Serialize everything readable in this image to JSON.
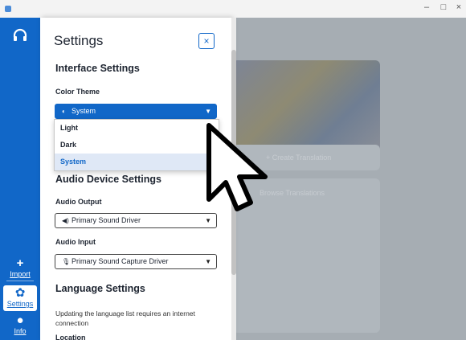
{
  "window": {
    "minimize": "–",
    "maximize": "□",
    "close": "×"
  },
  "rail": {
    "import_label": "Import",
    "settings_label": "Settings",
    "info_label": "Info"
  },
  "background": {
    "create_translation": "+ Create Translation",
    "browse_translations": "Browse Translations"
  },
  "settings": {
    "title": "Settings",
    "close_glyph": "×",
    "interface_heading": "Interface Settings",
    "color_theme_label": "Color Theme",
    "color_theme_value": "System",
    "theme_options": [
      "Light",
      "Dark",
      "System"
    ],
    "theme_selected_index": 2,
    "audio_heading": "Audio Device Settings",
    "audio_output_label": "Audio Output",
    "audio_output_value": "Primary Sound Driver",
    "audio_input_label": "Audio Input",
    "audio_input_value": "Primary Sound Capture Driver",
    "language_heading": "Language Settings",
    "language_note": "Updating the language list requires an internet connection",
    "location_label": "Location"
  },
  "colors": {
    "accent": "#1167c8",
    "selected_option_bg": "#dfe8f6"
  }
}
